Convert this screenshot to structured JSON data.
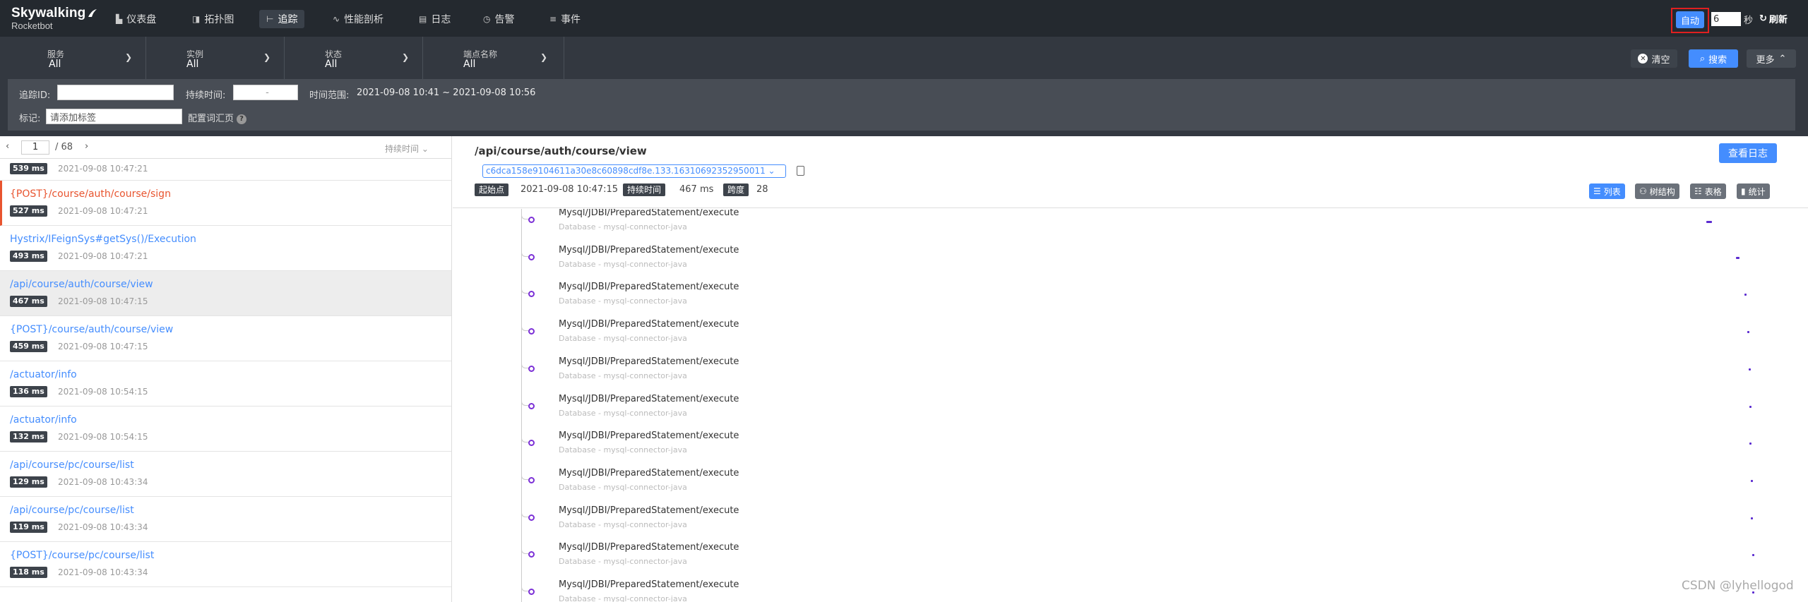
{
  "app": {
    "logo_line1": "Skywalking",
    "logo_line2": "Rocketbot"
  },
  "nav": [
    {
      "label": "仪表盘",
      "icon": "dashboard-icon",
      "active": false
    },
    {
      "label": "拓扑图",
      "icon": "topology-icon",
      "active": false
    },
    {
      "label": "追踪",
      "icon": "trace-icon",
      "active": true
    },
    {
      "label": "性能剖析",
      "icon": "profile-icon",
      "active": false
    },
    {
      "label": "日志",
      "icon": "log-icon",
      "active": false
    },
    {
      "label": "告警",
      "icon": "alarm-icon",
      "active": false
    },
    {
      "label": "事件",
      "icon": "event-icon",
      "active": false
    }
  ],
  "toolbar": {
    "auto_label": "自动",
    "interval_value": "6",
    "seconds_label": "秒",
    "refresh_label": "刷新"
  },
  "filters": [
    {
      "label": "服务",
      "value": "All"
    },
    {
      "label": "实例",
      "value": "All"
    },
    {
      "label": "状态",
      "value": "All"
    },
    {
      "label": "端点名称",
      "value": "All"
    }
  ],
  "actions": {
    "clear_label": "清空",
    "search_label": "搜索",
    "more_label": "更多"
  },
  "advanced": {
    "trace_id_label": "追踪ID:",
    "trace_id_value": "",
    "duration_label": "持续时间:",
    "duration_sep": "-",
    "time_range_label": "时间范围:",
    "time_range_value": "2021-09-08 10:41 ~ 2021-09-08 10:56",
    "tag_label": "标记:",
    "tag_placeholder": "请添加标签",
    "config_tags_label": "配置词汇页"
  },
  "pager": {
    "current": "1",
    "total": "/ 68",
    "sort_label": "持续时间"
  },
  "traces": [
    {
      "endpoint": "",
      "duration": "539 ms",
      "time": "2021-09-08 10:47:21",
      "error": false,
      "selected": false,
      "partial": true
    },
    {
      "endpoint": "{POST}/course/auth/course/sign",
      "duration": "527 ms",
      "time": "2021-09-08 10:47:21",
      "error": true,
      "selected": false
    },
    {
      "endpoint": "Hystrix/IFeignSys#getSys()/Execution",
      "duration": "493 ms",
      "time": "2021-09-08 10:47:21",
      "error": false,
      "selected": false
    },
    {
      "endpoint": "/api/course/auth/course/view",
      "duration": "467 ms",
      "time": "2021-09-08 10:47:15",
      "error": false,
      "selected": true
    },
    {
      "endpoint": "{POST}/course/auth/course/view",
      "duration": "459 ms",
      "time": "2021-09-08 10:47:15",
      "error": false,
      "selected": false
    },
    {
      "endpoint": "/actuator/info",
      "duration": "136 ms",
      "time": "2021-09-08 10:54:15",
      "error": false,
      "selected": false
    },
    {
      "endpoint": "/actuator/info",
      "duration": "132 ms",
      "time": "2021-09-08 10:54:15",
      "error": false,
      "selected": false
    },
    {
      "endpoint": "/api/course/pc/course/list",
      "duration": "129 ms",
      "time": "2021-09-08 10:43:34",
      "error": false,
      "selected": false
    },
    {
      "endpoint": "/api/course/pc/course/list",
      "duration": "119 ms",
      "time": "2021-09-08 10:43:34",
      "error": false,
      "selected": false
    },
    {
      "endpoint": "{POST}/course/pc/course/list",
      "duration": "118 ms",
      "time": "2021-09-08 10:43:34",
      "error": false,
      "selected": false
    }
  ],
  "detail": {
    "title": "/api/course/auth/course/view",
    "trace_id": "c6dca158e9104611a30e8c60898cdf8e.133.16310692352950011",
    "start_label": "起始点",
    "start_value": "2021-09-08 10:47:15",
    "duration_label": "持续时间",
    "duration_value": "467 ms",
    "span_label": "跨度",
    "span_value": "28",
    "view_log_label": "查看日志",
    "views": [
      {
        "label": "列表",
        "icon": "list-icon",
        "active": true
      },
      {
        "label": "树结构",
        "icon": "tree-icon",
        "active": false
      },
      {
        "label": "表格",
        "icon": "table-icon",
        "active": false
      },
      {
        "label": "统计",
        "icon": "stats-icon",
        "active": false
      }
    ]
  },
  "spans": [
    {
      "name": "Mysql/JDBI/PreparedStatement/execute",
      "sub": "Database - mysql-connector-java",
      "bar_start": 0.925,
      "bar_len": 0.004
    },
    {
      "name": "Mysql/JDBI/PreparedStatement/execute",
      "sub": "Database - mysql-connector-java",
      "bar_start": 0.947,
      "bar_len": 0.0025
    },
    {
      "name": "Mysql/JDBI/PreparedStatement/execute",
      "sub": "Database - mysql-connector-java",
      "bar_start": 0.953,
      "bar_len": 0.001
    },
    {
      "name": "Mysql/JDBI/PreparedStatement/execute",
      "sub": "Database - mysql-connector-java",
      "bar_start": 0.955,
      "bar_len": 0.001
    },
    {
      "name": "Mysql/JDBI/PreparedStatement/execute",
      "sub": "Database - mysql-connector-java",
      "bar_start": 0.956,
      "bar_len": 0.0012
    },
    {
      "name": "Mysql/JDBI/PreparedStatement/execute",
      "sub": "Database - mysql-connector-java",
      "bar_start": 0.957,
      "bar_len": 0.001
    },
    {
      "name": "Mysql/JDBI/PreparedStatement/execute",
      "sub": "Database - mysql-connector-java",
      "bar_start": 0.957,
      "bar_len": 0.001
    },
    {
      "name": "Mysql/JDBI/PreparedStatement/execute",
      "sub": "Database - mysql-connector-java",
      "bar_start": 0.958,
      "bar_len": 0.0008
    },
    {
      "name": "Mysql/JDBI/PreparedStatement/execute",
      "sub": "Database - mysql-connector-java",
      "bar_start": 0.958,
      "bar_len": 0.0008
    },
    {
      "name": "Mysql/JDBI/PreparedStatement/execute",
      "sub": "Database - mysql-connector-java",
      "bar_start": 0.959,
      "bar_len": 0.0008
    },
    {
      "name": "Mysql/JDBI/PreparedStatement/execute",
      "sub": "Database - mysql-connector-java",
      "bar_start": 0.959,
      "bar_len": 0.0008
    }
  ],
  "watermark": "CSDN @lyhellogod",
  "colors": {
    "accent": "#448dfe",
    "nav_bg": "#24292f",
    "error": "#e8542f",
    "span_bar": "#5b2bd0"
  }
}
